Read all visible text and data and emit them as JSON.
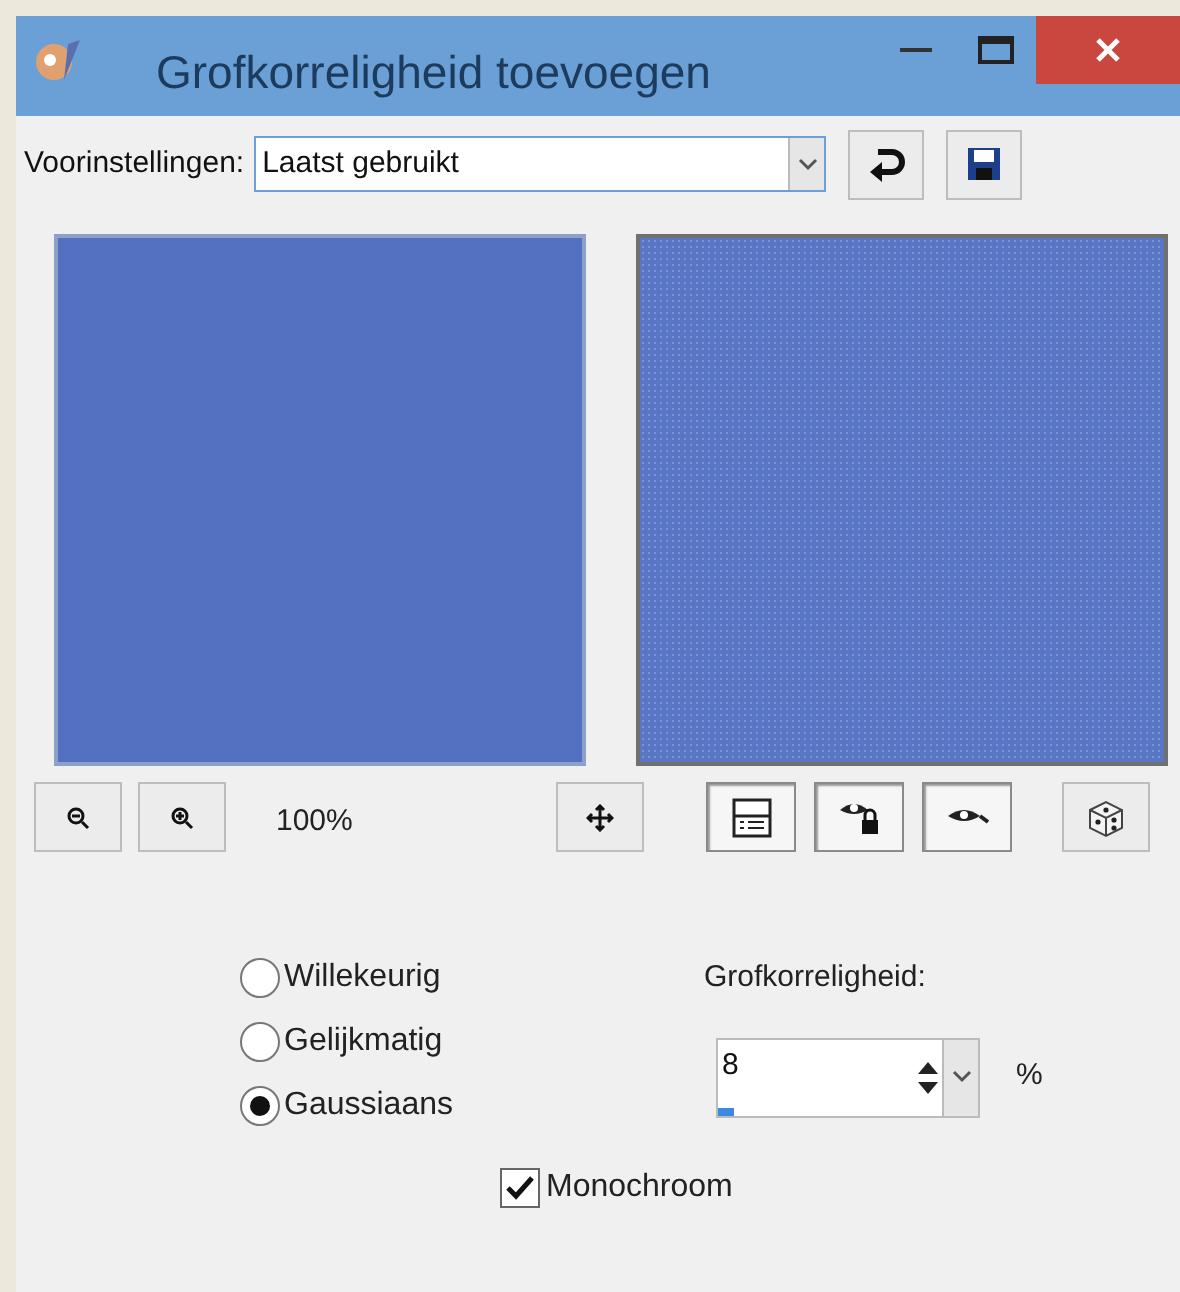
{
  "window": {
    "title": "Grofkorreligheid toevoegen"
  },
  "presets": {
    "label": "Voorinstellingen:",
    "value": "Laatst gebruikt"
  },
  "zoom": {
    "reading": "100%"
  },
  "toggles": [
    {
      "kind": "layout",
      "pressed": true
    },
    {
      "kind": "lock-eye",
      "pressed": true
    },
    {
      "kind": "eye",
      "pressed": true
    }
  ],
  "distribution": [
    {
      "label": "Willekeurig",
      "selected": false
    },
    {
      "label": "Gelijkmatig",
      "selected": false
    },
    {
      "label": "Gaussiaans",
      "selected": true
    }
  ],
  "amount": {
    "label": "Grofkorreligheid:",
    "value": "8",
    "level": 0.08,
    "unit": "%"
  },
  "monochrome": {
    "label": "Monochroom",
    "checked": true
  }
}
